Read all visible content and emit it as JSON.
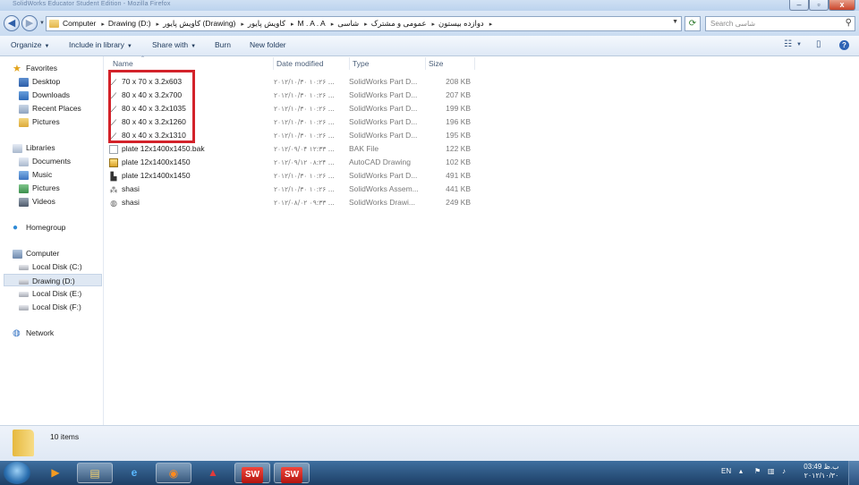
{
  "window": {
    "title": "SolidWorks Educator Student Edition - Mozilla Firefox",
    "controls": {
      "min": "–",
      "max": "▫",
      "close": "x"
    }
  },
  "address": {
    "crumbs": [
      "Computer",
      "Drawing (D:)",
      "کاویش پایور (Drawing)",
      "کاویش پایور",
      "M . A . A",
      "دوازده بیستون",
      "عمومی و مشترک",
      "شاسی"
    ],
    "separator": "▸",
    "search_placeholder": "Search شاسی"
  },
  "toolbar": {
    "organize": "Organize",
    "include_in_library": "Include in library",
    "share_with": "Share with",
    "burn": "Burn",
    "new_folder": "New folder"
  },
  "nav": {
    "favorites": "Favorites",
    "desktop": "Desktop",
    "downloads": "Downloads",
    "recent_places": "Recent Places",
    "pictures_fav": "Pictures",
    "libraries": "Libraries",
    "documents": "Documents",
    "music": "Music",
    "pictures": "Pictures",
    "videos": "Videos",
    "homegroup": "Homegroup",
    "computer": "Computer",
    "disk_c": "Local Disk (C:)",
    "disk_d": "Drawing (D:)",
    "disk_e": "Local Disk (E:)",
    "disk_f": "Local Disk (F:)",
    "network": "Network"
  },
  "columns": {
    "name": "Name",
    "date": "Date modified",
    "type": "Type",
    "size": "Size"
  },
  "files": [
    {
      "name": "70 x 70 x 3.2x603",
      "date": "۲۰۱۲/۱۰/۳۰ ۱۰:۲۶ ...",
      "type": "SolidWorks Part D...",
      "size": "208 KB",
      "icon": "part"
    },
    {
      "name": "80 x 40 x 3.2x700",
      "date": "۲۰۱۲/۱۰/۳۰ ۱۰:۲۶ ...",
      "type": "SolidWorks Part D...",
      "size": "207 KB",
      "icon": "part"
    },
    {
      "name": "80 x 40 x 3.2x1035",
      "date": "۲۰۱۲/۱۰/۳۰ ۱۰:۲۶ ...",
      "type": "SolidWorks Part D...",
      "size": "199 KB",
      "icon": "part"
    },
    {
      "name": "80 x 40 x 3.2x1260",
      "date": "۲۰۱۲/۱۰/۳۰ ۱۰:۲۶ ...",
      "type": "SolidWorks Part D...",
      "size": "196 KB",
      "icon": "part"
    },
    {
      "name": "80 x 40 x 3.2x1310",
      "date": "۲۰۱۲/۱۰/۳۰ ۱۰:۲۶ ...",
      "type": "SolidWorks Part D...",
      "size": "195 KB",
      "icon": "part"
    },
    {
      "name": "plate 12x1400x1450.bak",
      "date": "۲۰۱۲/۰۹/۰۴ ۱۲:۳۳ ...",
      "type": "BAK File",
      "size": "122 KB",
      "icon": "bak"
    },
    {
      "name": "plate 12x1400x1450",
      "date": "۲۰۱۲/۰۹/۱۲ ۰۸:۲۴ ...",
      "type": "AutoCAD Drawing",
      "size": "102 KB",
      "icon": "dwg"
    },
    {
      "name": "plate 12x1400x1450",
      "date": "۲۰۱۲/۱۰/۳۰ ۱۰:۲۶ ...",
      "type": "SolidWorks Part D...",
      "size": "491 KB",
      "icon": "part2"
    },
    {
      "name": "shasi",
      "date": "۲۰۱۲/۱۰/۳۰ ۱۰:۲۶ ...",
      "type": "SolidWorks Assem...",
      "size": "441 KB",
      "icon": "asm"
    },
    {
      "name": "shasi",
      "date": "۲۰۱۲/۰۸/۰۲ ۰۹:۳۳ ...",
      "type": "SolidWorks Drawi...",
      "size": "249 KB",
      "icon": "drw"
    }
  ],
  "status": {
    "items_count": "10 items"
  },
  "taskbar": {
    "sw_label": "SW",
    "lang": "EN",
    "clock_time": "03:49 ب.ظ",
    "clock_date": "۲۰۱۲/۱۰/۳۰"
  }
}
